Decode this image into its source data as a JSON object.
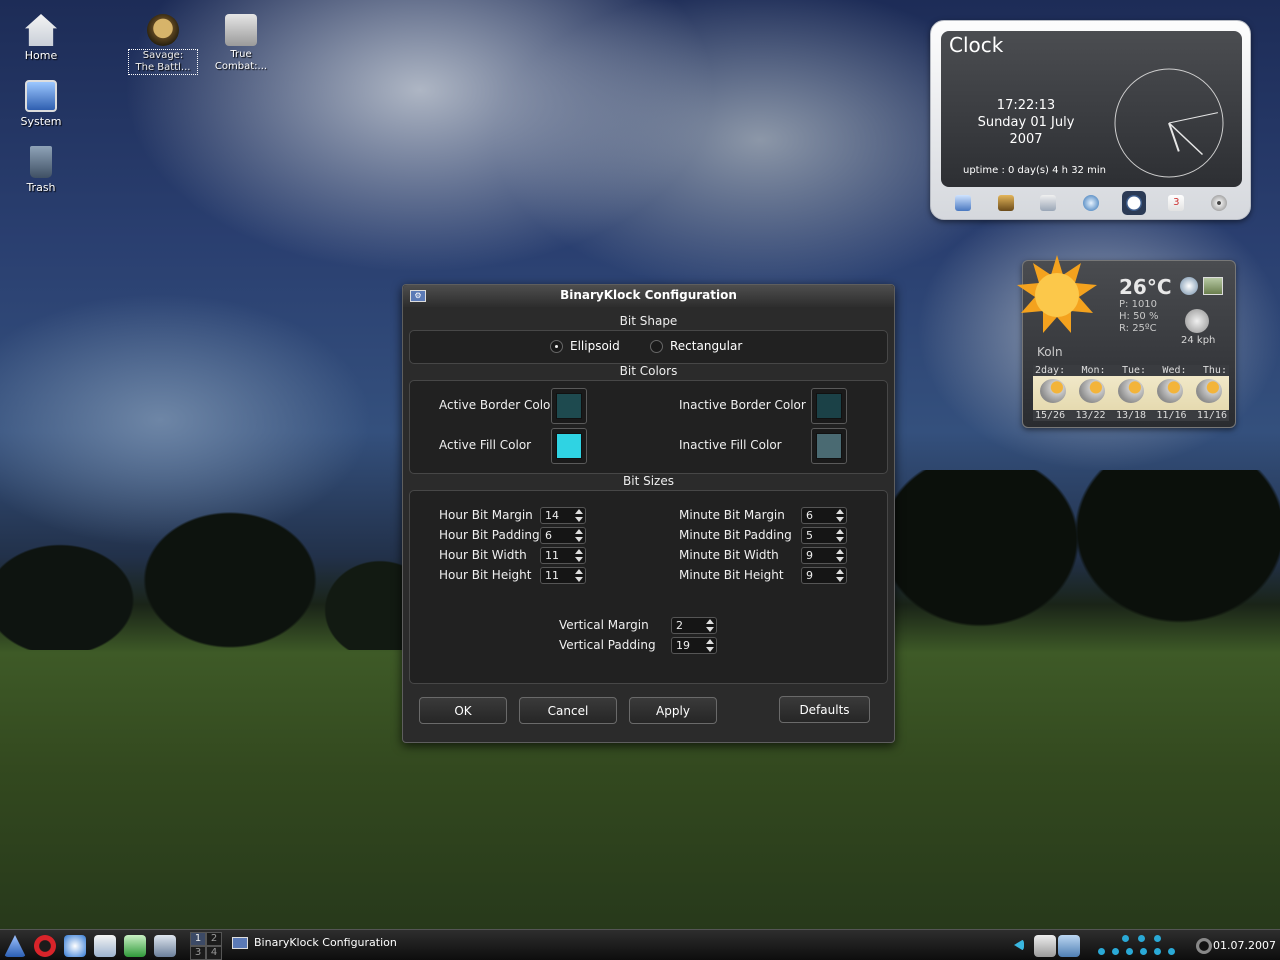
{
  "desktop": {
    "icons": [
      {
        "label": "Home",
        "icon": "home-icon"
      },
      {
        "label": "System",
        "icon": "computer-icon"
      },
      {
        "label": "Trash",
        "icon": "trash-icon"
      },
      {
        "label": "Savage:\nThe Battl...",
        "icon": "savage-game-icon"
      },
      {
        "label": "True\nCombat:...",
        "icon": "true-combat-game-icon"
      }
    ]
  },
  "clock_widget": {
    "title": "Clock",
    "time": "17:22:13",
    "date_line1": "Sunday 01 July",
    "date_line2": "2007",
    "uptime": "uptime : 0 day(s) 4 h 32 min",
    "analog": {
      "hour": 17,
      "minute": 22,
      "second": 13
    },
    "dock_icons": [
      "computer-icon",
      "cpu-icon",
      "drive-icon",
      "network-icon",
      "clock-icon",
      "calendar-icon",
      "cd-icon"
    ]
  },
  "weather_widget": {
    "temperature": "26°C",
    "pressure": "P: 1010",
    "humidity": "H: 50 %",
    "realfeel": "R: 25ºC",
    "wind": "24 kph",
    "city": "Koln",
    "forecast_days": [
      "2day:",
      "Mon:",
      "Tue:",
      "Wed:",
      "Thu:"
    ],
    "forecast_temps": [
      "15/26",
      "13/22",
      "13/18",
      "11/16",
      "11/16"
    ]
  },
  "dialog": {
    "title": "BinaryKlock Configuration",
    "bit_shape": {
      "title": "Bit Shape",
      "options": [
        {
          "label": "Ellipsoid",
          "mnemonic": "l",
          "checked": true
        },
        {
          "label": "Rectangular",
          "mnemonic": "R",
          "checked": false
        }
      ]
    },
    "bit_colors": {
      "title": "Bit Colors",
      "active_border_label": "Active Border Color",
      "active_fill_label": "Active Fill Color",
      "inactive_border_label": "Inactive Border Color",
      "inactive_fill_label": "Inactive Fill Color",
      "colors": {
        "active_border": "#1e4a4f",
        "active_fill": "#2fd3e3",
        "inactive_border": "#1b4147",
        "inactive_fill": "#4a6a72"
      }
    },
    "bit_sizes": {
      "title": "Bit Sizes",
      "hour": [
        {
          "label": "Hour Bit Margin",
          "value": "14"
        },
        {
          "label": "Hour Bit Padding",
          "value": "6"
        },
        {
          "label": "Hour Bit Width",
          "value": "11"
        },
        {
          "label": "Hour Bit Height",
          "value": "11"
        }
      ],
      "minute": [
        {
          "label": "Minute Bit Margin",
          "value": "6"
        },
        {
          "label": "Minute Bit Padding",
          "value": "5"
        },
        {
          "label": "Minute Bit Width",
          "value": "9"
        },
        {
          "label": "Minute Bit Height",
          "value": "9"
        }
      ],
      "vertical_margin_label": "Vertical Margin",
      "vertical_margin": "2",
      "vertical_padding_label": "Vertical Padding",
      "vertical_padding": "19"
    },
    "buttons": {
      "ok": "OK",
      "cancel": "Cancel",
      "apply": "Apply",
      "defaults": "Defaults"
    }
  },
  "taskbar": {
    "pager": [
      "1",
      "2",
      "3",
      "4"
    ],
    "active_task": "BinaryKlock Configuration",
    "date": "01.07.2007",
    "launchers": [
      "kde-menu-icon",
      "opera-icon",
      "konqueror-icon",
      "file-manager-icon",
      "app-icon",
      "terminal-icon"
    ]
  }
}
